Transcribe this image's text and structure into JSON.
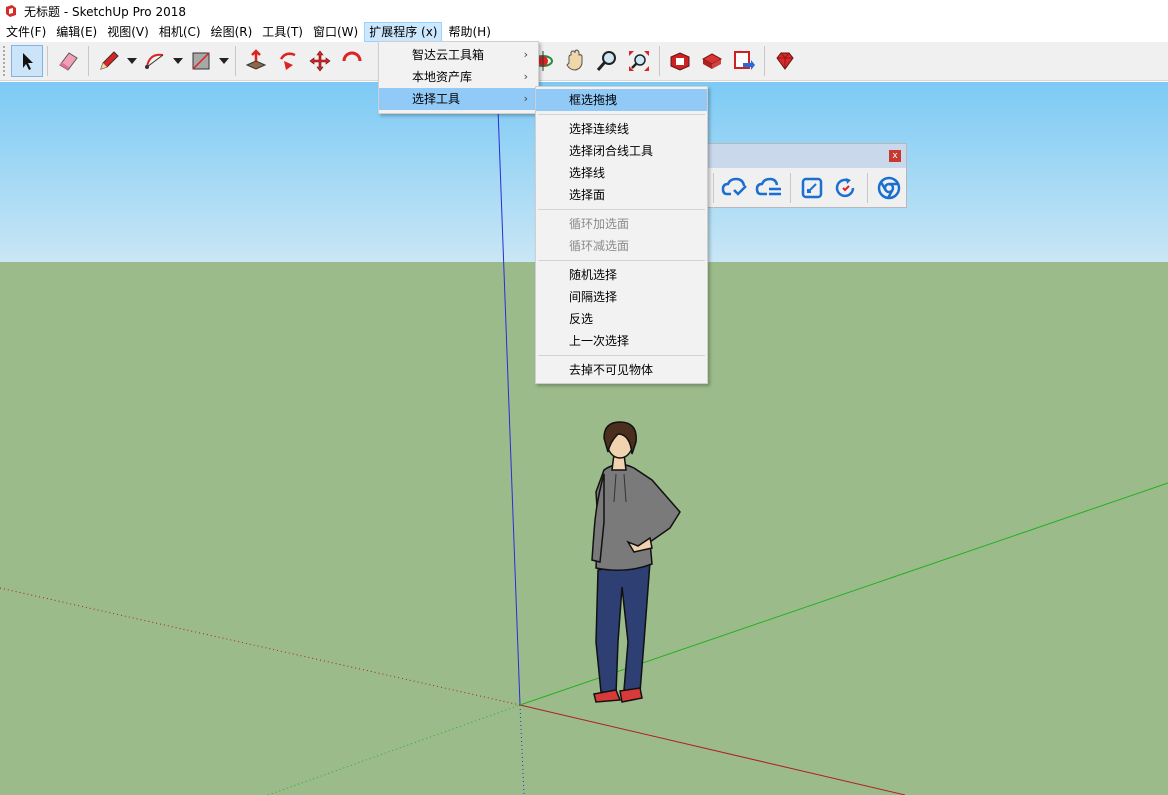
{
  "window": {
    "title": "无标题 - SketchUp Pro 2018"
  },
  "menubar": {
    "items": [
      {
        "label": "文件(F)"
      },
      {
        "label": "编辑(E)"
      },
      {
        "label": "视图(V)"
      },
      {
        "label": "相机(C)"
      },
      {
        "label": "绘图(R)"
      },
      {
        "label": "工具(T)"
      },
      {
        "label": "窗口(W)"
      },
      {
        "label": "扩展程序 (x)"
      },
      {
        "label": "帮助(H)"
      }
    ]
  },
  "extensions_menu": {
    "items": [
      {
        "label": "智达云工具箱",
        "arrow": "›"
      },
      {
        "label": "本地资产库",
        "arrow": "›"
      },
      {
        "label": "选择工具",
        "arrow": "›"
      }
    ]
  },
  "selection_submenu": {
    "items": [
      {
        "label": "框选拖拽"
      },
      {
        "label": "选择连续线"
      },
      {
        "label": "选择闭合线工具"
      },
      {
        "label": "选择线"
      },
      {
        "label": "选择面"
      },
      {
        "label": "循环加选面"
      },
      {
        "label": "循环减选面"
      },
      {
        "label": "随机选择"
      },
      {
        "label": "间隔选择"
      },
      {
        "label": "反选"
      },
      {
        "label": "上一次选择"
      },
      {
        "label": "去掉不可见物体"
      }
    ]
  },
  "float_toolbar": {
    "close_label": "x"
  },
  "colors": {
    "sky": "#7ccaf5",
    "ground": "#9bbb8b",
    "axis_blue": "#2c2cd8",
    "axis_green": "#23b023",
    "axis_red": "#b02020",
    "menu_highlight": "#91c9f7",
    "sketchup_red": "#d42a2a"
  }
}
